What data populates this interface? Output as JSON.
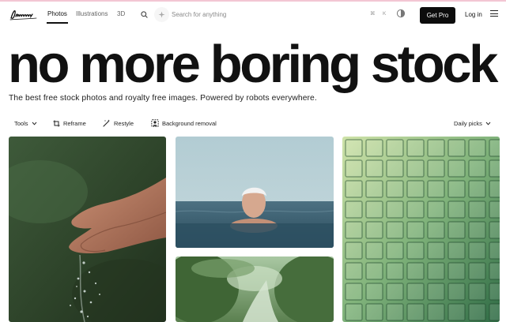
{
  "brand": {
    "name": "Lummi"
  },
  "nav": {
    "links": [
      "Photos",
      "Illustrations",
      "3D"
    ],
    "search_placeholder": "Search for anything",
    "kbd": [
      "⌘",
      "K"
    ],
    "get_pro": "Get Pro",
    "login": "Log in"
  },
  "hero": {
    "title": "no more boring stock",
    "subtitle": "The best free stock photos and royalty free images. Powered by robots everywhere."
  },
  "toolbar": {
    "tools": "Tools",
    "reframe": "Reframe",
    "restyle": "Restyle",
    "background_removal": "Background removal",
    "sort": "Daily picks"
  },
  "icons": {
    "search": "search-icon",
    "sparkle": "sparkle-icon",
    "theme": "theme-toggle-icon",
    "menu": "menu-icon",
    "reframe": "crop-icon",
    "restyle": "magic-wand-icon",
    "background_removal": "background-removal-icon",
    "chevron": "chevron-down-icon"
  },
  "colors": {
    "pro_button": "#0c0c0c",
    "accent_line": "#f3c6d3"
  }
}
